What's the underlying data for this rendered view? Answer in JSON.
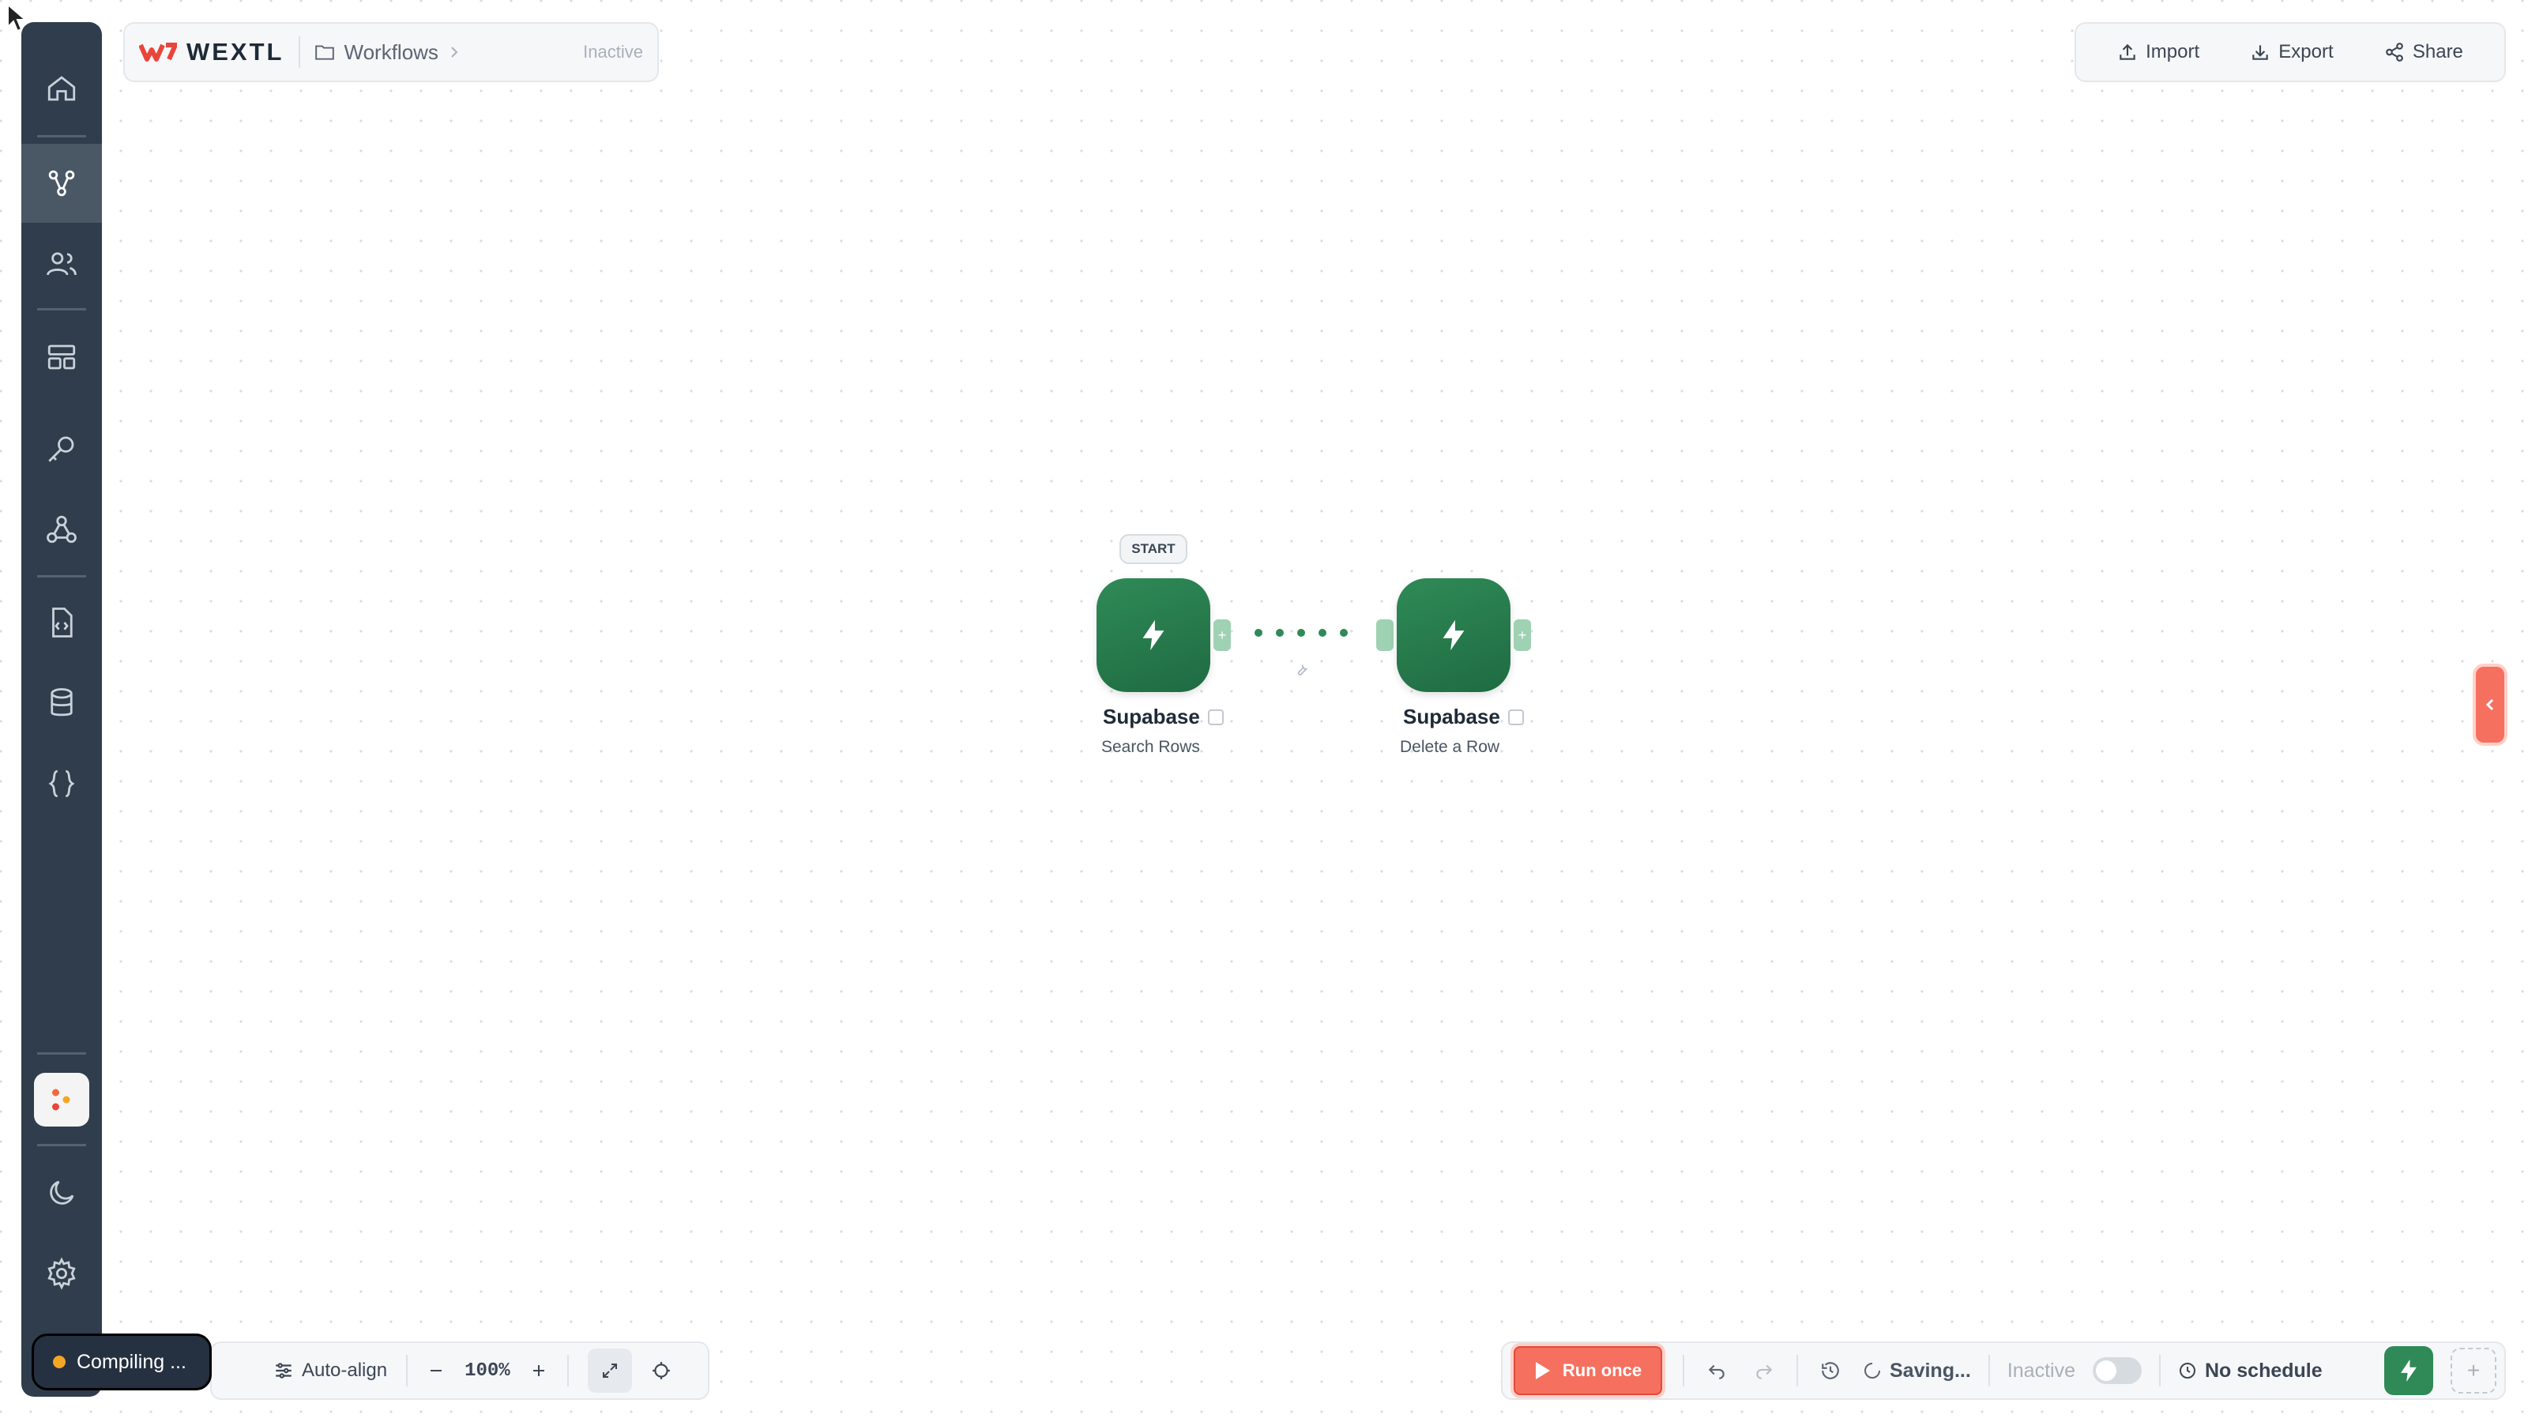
{
  "sidebar": {
    "items": [
      {
        "icon": "home-icon"
      },
      {
        "icon": "workflow-icon",
        "active": true
      },
      {
        "icon": "users-icon"
      },
      {
        "icon": "templates-icon"
      },
      {
        "icon": "key-icon"
      },
      {
        "icon": "webhook-icon"
      },
      {
        "icon": "file-code-icon"
      },
      {
        "icon": "database-icon"
      },
      {
        "icon": "braces-icon"
      },
      {
        "icon": "moon-icon"
      },
      {
        "icon": "gear-icon"
      }
    ]
  },
  "header": {
    "brand": "WEXTL",
    "breadcrumb": "Workflows",
    "status": "Inactive"
  },
  "top_actions": {
    "import": "Import",
    "export": "Export",
    "share": "Share"
  },
  "canvas": {
    "start_badge": "START",
    "nodes": [
      {
        "title": "Supabase",
        "subtitle": "Search Rows"
      },
      {
        "title": "Supabase",
        "subtitle": "Delete a Row"
      }
    ]
  },
  "status_pill": {
    "text": "Compiling ..."
  },
  "bottom_left": {
    "auto_align": "Auto-align",
    "zoom": "100%"
  },
  "bottom_right": {
    "run_once": "Run once",
    "saving": "Saving...",
    "inactive": "Inactive",
    "schedule": "No schedule"
  },
  "colors": {
    "sidebar": "#2f3d4c",
    "node_green": "#2f8a57",
    "accent_red": "#f5705f"
  }
}
